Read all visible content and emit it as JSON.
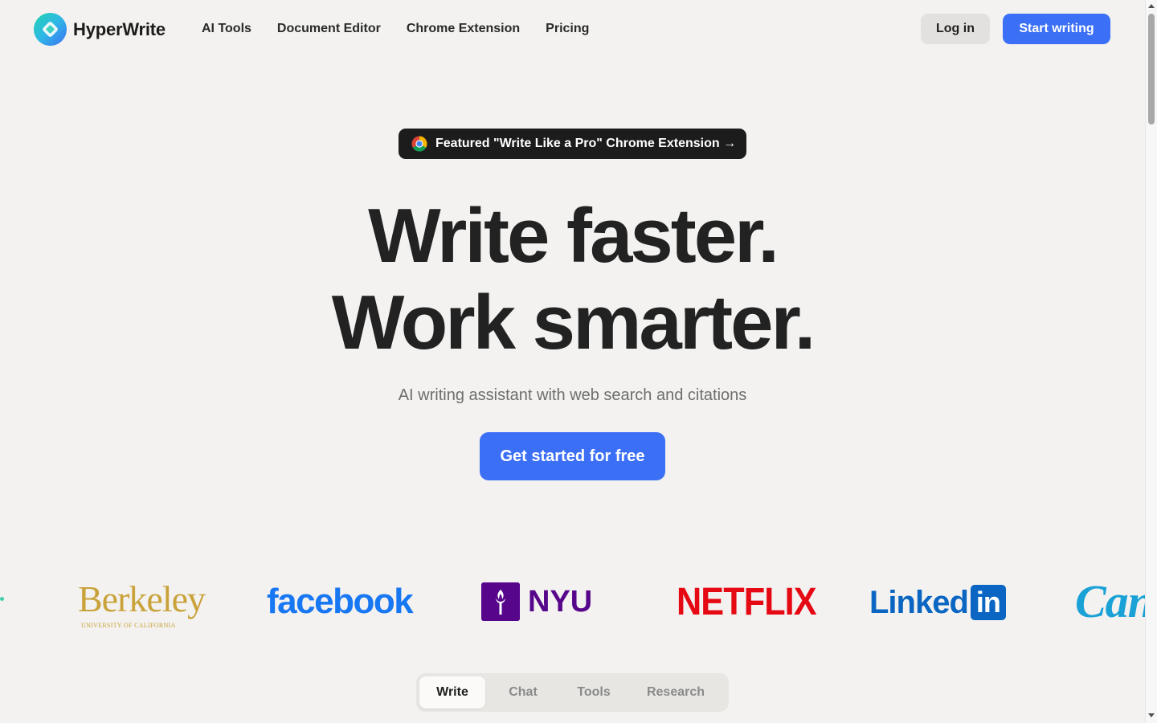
{
  "header": {
    "brand_name": "HyperWrite",
    "nav": [
      {
        "label": "AI Tools"
      },
      {
        "label": "Document Editor"
      },
      {
        "label": "Chrome Extension"
      },
      {
        "label": "Pricing"
      }
    ],
    "login_label": "Log in",
    "start_label": "Start writing"
  },
  "hero": {
    "badge_text": "Featured \"Write Like a Pro\" Chrome Extension →",
    "headline_line1": "Write faster.",
    "headline_line2": "Work smarter.",
    "subheadline": "AI writing assistant with web search and citations",
    "cta_label": "Get started for free"
  },
  "logos": {
    "berkeley": "Berkeley",
    "berkeley_sub": "UNIVERSITY OF CALIFORNIA",
    "facebook": "facebook",
    "nyu": "NYU",
    "netflix": "NETFLIX",
    "linkedin_word": "Linked",
    "linkedin_box": "in",
    "canva": "Can"
  },
  "tabs": [
    {
      "label": "Write",
      "active": true
    },
    {
      "label": "Chat",
      "active": false
    },
    {
      "label": "Tools",
      "active": false
    },
    {
      "label": "Research",
      "active": false
    }
  ],
  "colors": {
    "background": "#f3f2f0",
    "accent_blue": "#3b6ff5",
    "badge_dark": "#1c1c1c",
    "berkeley_gold": "#c9a23a",
    "facebook_blue": "#1877f2",
    "nyu_purple": "#57068c",
    "netflix_red": "#e50914",
    "linkedin_blue": "#0a66c2",
    "canva_teal": "#1aa1d6"
  },
  "icons": {
    "brand_logo": "hyperwrite-logo-icon",
    "badge_icon": "chrome-icon",
    "nyu_icon": "nyu-torch-icon"
  }
}
